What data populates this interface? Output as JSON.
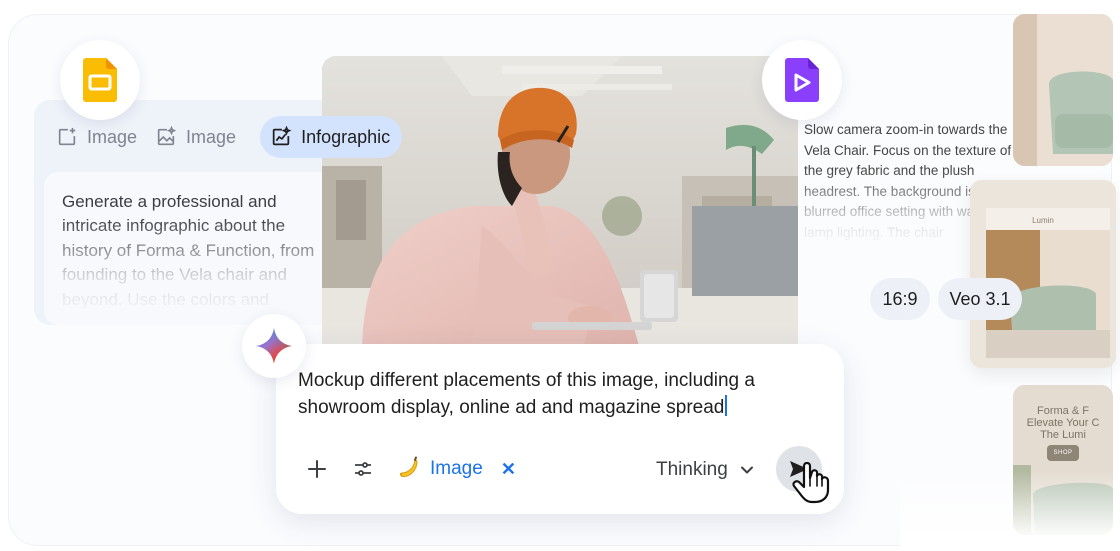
{
  "left_panel": {
    "type_options": [
      {
        "label": "Image",
        "icon": "image-add-icon",
        "active": false
      },
      {
        "label": "Image",
        "icon": "image-edit-icon",
        "active": false
      },
      {
        "label": "Infographic",
        "icon": "infographic-icon",
        "active": true
      }
    ],
    "prompt": "Generate a professional and intricate infographic about the history of Forma & Function, from founding to the Vela chair and beyond. Use the colors and"
  },
  "badges": {
    "slides": "google-slides-icon",
    "vids": "google-vids-icon",
    "gemini": "gemini-sparkle-icon"
  },
  "composer": {
    "text": "Mockup different placements of this image, including a showroom display, online ad and magazine spread",
    "tool_chip_label": "Image",
    "tool_chip_close": "✕",
    "mode_label": "Thinking",
    "colors": {
      "accent": "#1a73e8",
      "chip_active": "#d3e2fd"
    }
  },
  "video_panel": {
    "prompt": "Slow camera zoom-in towards the Vela Chair. Focus on the texture of the grey fabric and the plush headrest. The background is cozy, blurred office setting with warm lamp lighting. The chair",
    "aspect_ratio": "16:9",
    "model": "Veo 3.1"
  },
  "thumbnails": {
    "showroom_label": "Lumin",
    "ad_lines": [
      "Forma & F",
      "Elevate Your C",
      "The Lumi"
    ],
    "ad_button": "SHOP"
  }
}
